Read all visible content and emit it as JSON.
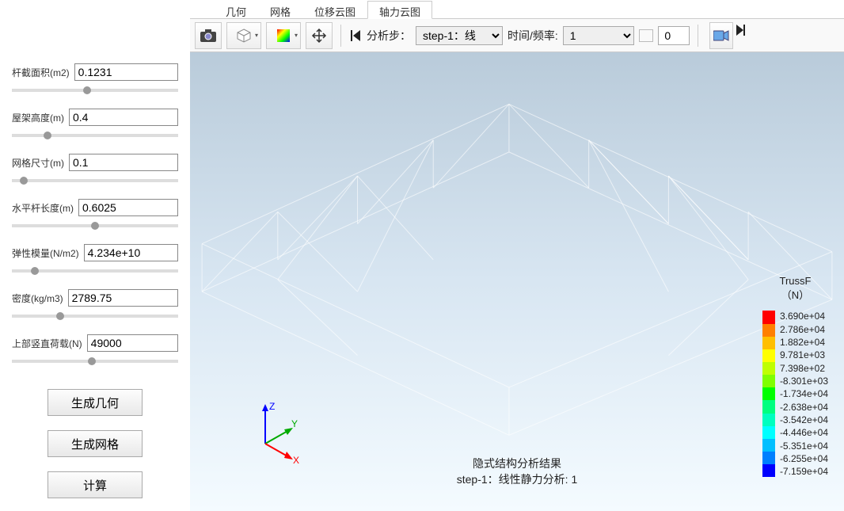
{
  "tabs": [
    "几何",
    "网格",
    "位移云图",
    "轴力云图"
  ],
  "active_tab": 3,
  "params": [
    {
      "label": "杆截面积(m2)",
      "value": "0.1231",
      "slider": 45
    },
    {
      "label": "屋架高度(m)",
      "value": "0.4",
      "slider": 20
    },
    {
      "label": "网格尺寸(m)",
      "value": "0.1",
      "slider": 5
    },
    {
      "label": "水平杆长度(m)",
      "value": "0.6025",
      "slider": 50
    },
    {
      "label": "弹性模量(N/m2)",
      "value": "4.234e+10",
      "slider": 12
    },
    {
      "label": "密度(kg/m3)",
      "value": "2789.75",
      "slider": 28
    },
    {
      "label": "上部竖直荷载(N)",
      "value": "49000",
      "slider": 48
    }
  ],
  "buttons": {
    "geom": "生成几何",
    "mesh": "生成网格",
    "calc": "计算"
  },
  "toolbar": {
    "step_label": "分析步：",
    "step_value": "step-1：线",
    "time_label": "时间/频率:",
    "time_value": "1",
    "spin_value": "0"
  },
  "result": {
    "line1": "隐式结构分析结果",
    "line2": "step-1：线性静力分析: 1"
  },
  "legend": {
    "title1": "TrussF",
    "title2": "（N）",
    "colors": [
      "#ff0000",
      "#ff7f00",
      "#ffbf00",
      "#ffff00",
      "#bfff00",
      "#7fff00",
      "#00ff00",
      "#00ff7f",
      "#00ffbf",
      "#00ffff",
      "#00bfff",
      "#007fff",
      "#0000ff"
    ],
    "values": [
      "3.690e+04",
      "2.786e+04",
      "1.882e+04",
      "9.781e+03",
      "7.398e+02",
      "-8.301e+03",
      "-1.734e+04",
      "-2.638e+04",
      "-3.542e+04",
      "-4.446e+04",
      "-5.351e+04",
      "-6.255e+04",
      "-7.159e+04"
    ]
  },
  "axes": {
    "x": "X",
    "y": "Y",
    "z": "Z"
  }
}
